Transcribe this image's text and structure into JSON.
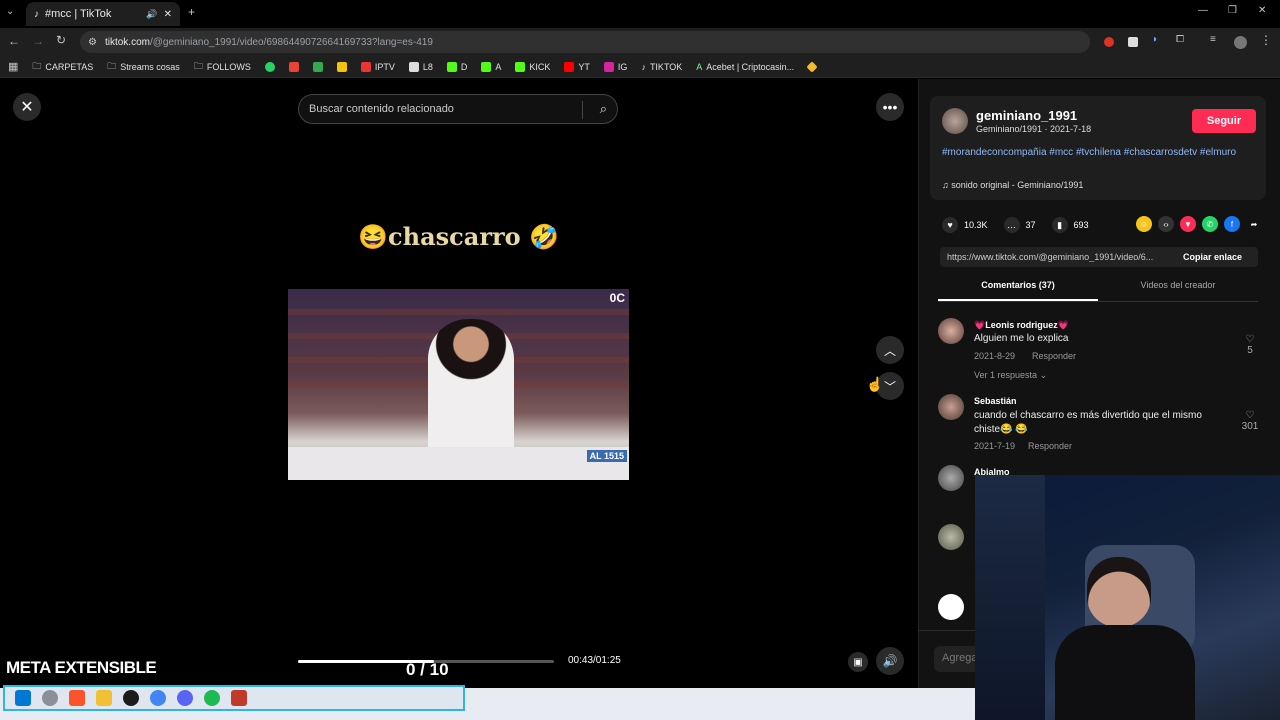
{
  "browser": {
    "tab_title": "#mcc | TikTok",
    "url_host": "tiktok.com",
    "url_path": "/@geminiano_1991/video/6986449072664169733?lang=es-419",
    "bookmarks": [
      "CARPETAS",
      "Streams cosas",
      "FOLLOWS",
      "IPTV",
      "L8",
      "D",
      "A",
      "KICK",
      "YT",
      "IG",
      "TIKTOK",
      "Acebet | Criptocasin..."
    ]
  },
  "video": {
    "search_placeholder": "Buscar contenido relacionado",
    "caption": "😆chascarro 🤣",
    "corner_tag": "0C",
    "channel_logo": "AL 1515",
    "time": "00:43/01:25",
    "progress": 0.53
  },
  "author": {
    "username": "geminiano_1991",
    "subtitle": "Geminiano/1991 · 2021-7-18",
    "follow_label": "Seguir",
    "hashtags": "#morandeconcompañia #mcc #tvchilena #chascarrosdetv #elmuro",
    "sound": "sonido original - Geminiano/1991"
  },
  "stats": {
    "likes": "10.3K",
    "comments": "37",
    "saves": "693"
  },
  "share": {
    "link": "https://www.tiktok.com/@geminiano_1991/video/6...",
    "copy_label": "Copiar enlace"
  },
  "tabs": [
    "Comentarios (37)",
    "Videos del creador"
  ],
  "comments": [
    {
      "name": "💗Leonis rodriguez💗",
      "text": "Alguien me lo explica",
      "date": "2021-8-29",
      "reply": "Responder",
      "likes": "5",
      "replies": "Ver 1 respuesta"
    },
    {
      "name": "Sebastián",
      "text": "cuando el chascarro es más divertido que el mismo chiste😂 😂",
      "date": "2021-7-19",
      "reply": "Responder",
      "likes": "301"
    },
    {
      "name": "Abialmo"
    }
  ],
  "comment_input_placeholder": "Agrega",
  "overlay": {
    "meta_label": "META EXTENSIBLE",
    "counter": "0 / 10"
  },
  "colors": {
    "accent": "#fe2c55",
    "hashtag": "#8fb7f5",
    "taskbar_border": "#2cb5e8"
  }
}
